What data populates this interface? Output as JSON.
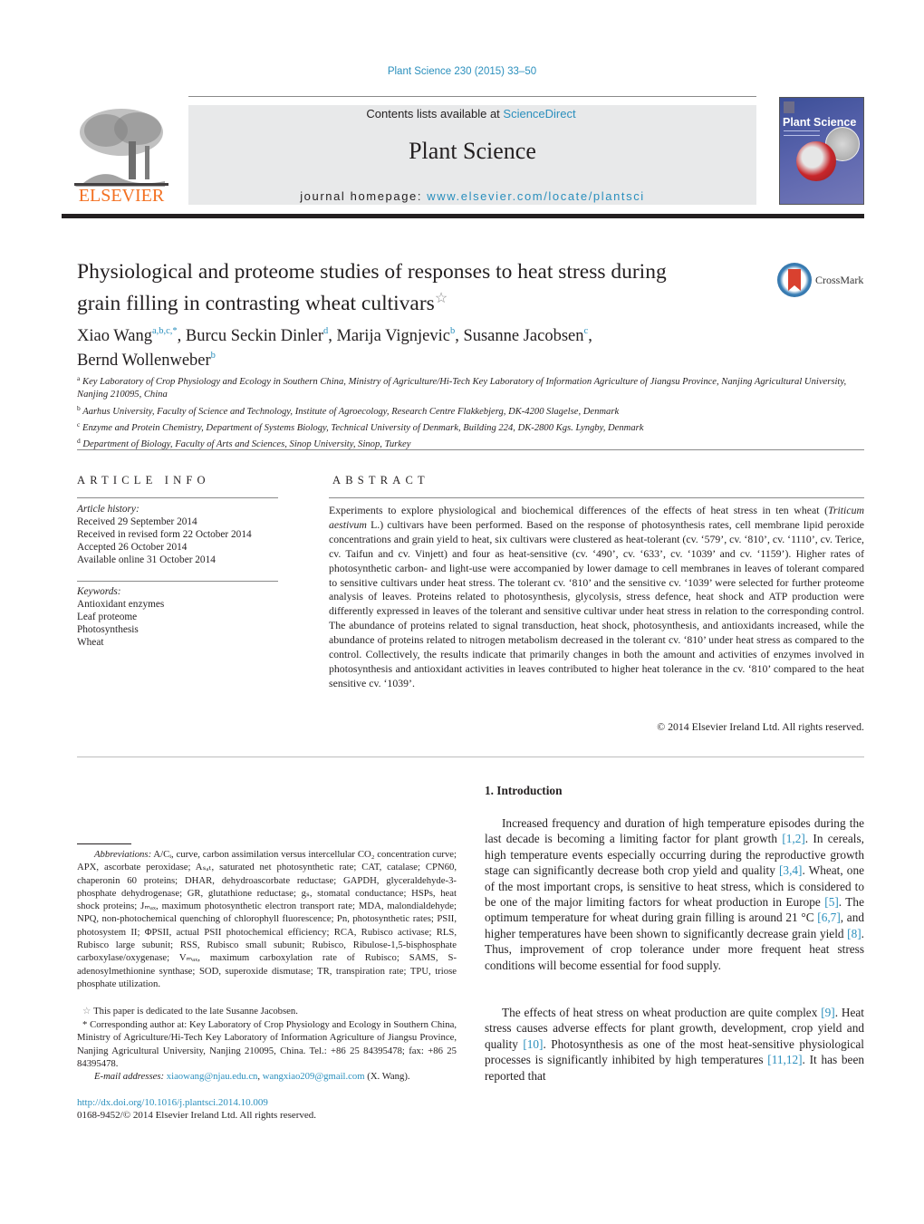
{
  "header": {
    "citation": "Plant Science 230 (2015) 33–50",
    "contents_prefix": "Contents lists available at ",
    "contents_link": "ScienceDirect",
    "journal_title": "Plant Science",
    "homepage_prefix": "journal homepage: ",
    "homepage_link": "www.elsevier.com/locate/plantsci",
    "publisher_logo_text": "ELSEVIER",
    "cover_title": "Plant Science",
    "crossmark_label": "CrossMark",
    "colors": {
      "link": "#2a8fbd",
      "elsevier_orange": "#f37021",
      "masthead_bg": "#e8e9ea"
    }
  },
  "article": {
    "title_line1": "Physiological and proteome studies of responses to heat stress during",
    "title_line2": "grain filling in contrasting wheat cultivars",
    "title_note_symbol": "☆",
    "authors": [
      {
        "name": "Xiao Wang",
        "affil": "a,b,c,",
        "corr": "*",
        "sep": ", "
      },
      {
        "name": "Burcu Seckin Dinler",
        "affil": "d",
        "sep": ", "
      },
      {
        "name": "Marija Vignjevic",
        "affil": "b",
        "sep": ", "
      },
      {
        "name": "Susanne Jacobsen",
        "affil": "c",
        "sep": ","
      },
      {
        "name": "Bernd Wollenweber",
        "affil": "b",
        "sep": ""
      }
    ],
    "affiliations": [
      {
        "key": "a",
        "text": "Key Laboratory of Crop Physiology and Ecology in Southern China, Ministry of Agriculture/Hi-Tech Key Laboratory of Information Agriculture of Jiangsu Province, Nanjing Agricultural University, Nanjing 210095, China"
      },
      {
        "key": "b",
        "text": "Aarhus University, Faculty of Science and Technology, Institute of Agroecology, Research Centre Flakkebjerg, DK-4200 Slagelse, Denmark"
      },
      {
        "key": "c",
        "text": "Enzyme and Protein Chemistry, Department of Systems Biology, Technical University of Denmark, Building 224, DK-2800 Kgs. Lyngby, Denmark"
      },
      {
        "key": "d",
        "text": "Department of Biology, Faculty of Arts and Sciences, Sinop University, Sinop, Turkey"
      }
    ]
  },
  "article_info": {
    "heading": "ARTICLE INFO",
    "history_label": "Article history:",
    "history": [
      "Received 29 September 2014",
      "Received in revised form 22 October 2014",
      "Accepted 26 October 2014",
      "Available online 31 October 2014"
    ],
    "keywords_label": "Keywords:",
    "keywords": [
      "Antioxidant enzymes",
      "Leaf proteome",
      "Photosynthesis",
      "Wheat"
    ]
  },
  "abstract": {
    "heading": "ABSTRACT",
    "part1": "Experiments to explore physiological and biochemical differences of the effects of heat stress in ten wheat (",
    "species": "Triticum aestivum",
    "part2": " L.) cultivars have been performed. Based on the response of photosynthesis rates, cell membrane lipid peroxide concentrations and grain yield to heat, six cultivars were clustered as heat-tolerant (cv. ‘579’, cv. ‘810’, cv. ‘1110’, cv. Terice, cv. Taifun and cv. Vinjett) and four as heat-sensitive (cv. ‘490’, cv. ‘633’, cv. ‘1039’ and cv. ‘1159’). Higher rates of photosynthetic carbon- and light-use were accompanied by lower damage to cell membranes in leaves of tolerant compared to sensitive cultivars under heat stress. The tolerant cv. ‘810’ and the sensitive cv. ‘1039’ were selected for further proteome analysis of leaves. Proteins related to photosynthesis, glycolysis, stress defence, heat shock and ATP production were differently expressed in leaves of the tolerant and sensitive cultivar under heat stress in relation to the corresponding control. The abundance of proteins related to signal transduction, heat shock, photosynthesis, and antioxidants increased, while the abundance of proteins related to nitrogen metabolism decreased in the tolerant cv. ‘810’ under heat stress as compared to the control. Collectively, the results indicate that primarily changes in both the amount and activities of enzymes involved in photosynthesis and antioxidant activities in leaves contributed to higher heat tolerance in the cv. ‘810’ compared to the heat sensitive cv. ‘1039’.",
    "copyright": "© 2014 Elsevier Ireland Ltd. All rights reserved."
  },
  "footnotes": {
    "abbrev_label": "Abbreviations:",
    "abbrev_text": " A/Cᵢ, curve, carbon assimilation versus intercellular CO₂ concentration curve; APX, ascorbate peroxidase; Aₛₐₜ, saturated net photosynthetic rate; CAT, catalase; CPN60, chaperonin 60 proteins; DHAR, dehydroascorbate reductase; GAPDH, glyceraldehyde-3-phosphate dehydrogenase; GR, glutathione reductase; gₛ, stomatal conductance; HSPs, heat shock proteins; Jₘₐₓ, maximum photosynthetic electron transport rate; MDA, malondialdehyde; NPQ, non-photochemical quenching of chlorophyll fluorescence; Pn, photosynthetic rates; PSII, photosystem II; ΦPSII, actual PSII photochemical efficiency; RCA, Rubisco activase; RLS, Rubisco large subunit; RSS, Rubisco small subunit; Rubisco, Ribulose-1,5-bisphosphate carboxylase/oxygenase; Vₘₐₓ, maximum carboxylation rate of Rubisco; SAMS, S-adenosylmethionine synthase; SOD, superoxide dismutase; TR, transpiration rate; TPU, triose phosphate utilization.",
    "dedication_symbol": "☆",
    "dedication": " This paper is dedicated to the late Susanne Jacobsen.",
    "corresponding_symbol": "*",
    "corresponding": " Corresponding author at: Key Laboratory of Crop Physiology and Ecology in Southern China, Ministry of Agriculture/Hi-Tech Key Laboratory of Information Agriculture of Jiangsu Province, Nanjing Agricultural University, Nanjing 210095, China. Tel.: +86 25 84395478; fax: +86 25 84395478.",
    "email_label": "E-mail addresses:",
    "email1": "xiaowang@njau.edu.cn",
    "email_sep": ", ",
    "email2": "wangxiao209@gmail.com",
    "email_suffix": " (X. Wang).",
    "doi": "http://dx.doi.org/10.1016/j.plantsci.2014.10.009",
    "issn": "0168-9452/© 2014 Elsevier Ireland Ltd. All rights reserved."
  },
  "introduction": {
    "heading": "1.  Introduction",
    "p1": [
      {
        "t": "Increased frequency and duration of high temperature episodes during the last decade is becoming a limiting factor for plant growth "
      },
      {
        "ref": "[1,2]"
      },
      {
        "t": ". In cereals, high temperature events especially occurring during the reproductive growth stage can significantly decrease both crop yield and quality "
      },
      {
        "ref": "[3,4]"
      },
      {
        "t": ". Wheat, one of the most important crops, is sensitive to heat stress, which is considered to be one of the major limiting factors for wheat production in Europe "
      },
      {
        "ref": "[5]"
      },
      {
        "t": ". The optimum temperature for wheat during grain filling is around 21 °C "
      },
      {
        "ref": "[6,7]"
      },
      {
        "t": ", and higher temperatures have been shown to significantly decrease grain yield "
      },
      {
        "ref": "[8]"
      },
      {
        "t": ". Thus, improvement of crop tolerance under more frequent heat stress conditions will become essential for food supply."
      }
    ],
    "p2": [
      {
        "t": "The effects of heat stress on wheat production are quite complex "
      },
      {
        "ref": "[9]"
      },
      {
        "t": ". Heat stress causes adverse effects for plant growth, development, crop yield and quality "
      },
      {
        "ref": "[10]"
      },
      {
        "t": ". Photosynthesis as one of the most heat-sensitive physiological processes is significantly inhibited by high temperatures "
      },
      {
        "ref": "[11,12]"
      },
      {
        "t": ". It has been reported that"
      }
    ]
  }
}
